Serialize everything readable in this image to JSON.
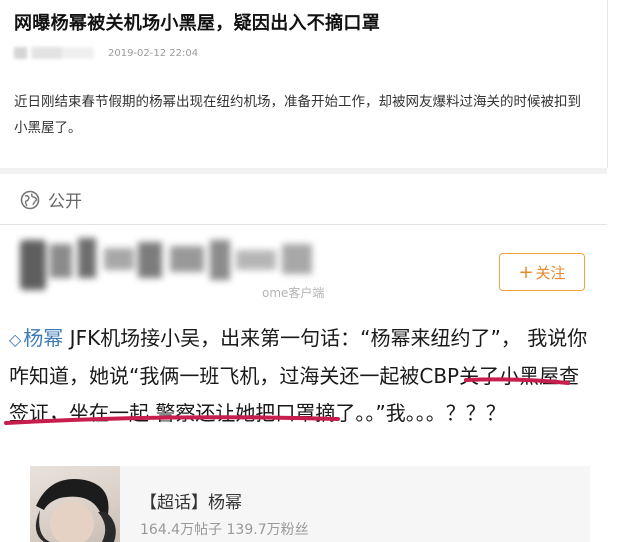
{
  "article": {
    "title": "网曝杨幂被关机场小黑屋，疑因出入不摘口罩",
    "date": "2019-02-12 22:04",
    "body": "近日刚结束春节假期的杨幂出现在纽约机场，准备开始工作，却被网友爆料过海关的时候被扣到小黑屋了。"
  },
  "visibility": {
    "icon": "globe-icon",
    "label": "公开"
  },
  "poster": {
    "source_partial": "ome客户端"
  },
  "follow_button": {
    "plus": "+",
    "label": "关注"
  },
  "post": {
    "topic_icon": "diamond-topic-icon",
    "topic": "杨幂",
    "text_1": " JFK机场接小吴，出来第一句话：“杨幂来纽约了”， 我说你咋知道，她说“我俩一班飞机，",
    "text_highlight_a": "过海关还",
    "text_highlight_b": "一起被CBP关了小黑屋查签证",
    "text_2": "，坐在一起 警察还让她把口罩摘了。。”我。。。？？？"
  },
  "topic_card": {
    "name": "【超话】杨幂",
    "stats": "164.4万帖子 139.7万粉丝"
  },
  "colors": {
    "accent_orange": "#e8892a",
    "link_blue": "#3d7bb8",
    "annotation_red": "#c81e4e"
  }
}
